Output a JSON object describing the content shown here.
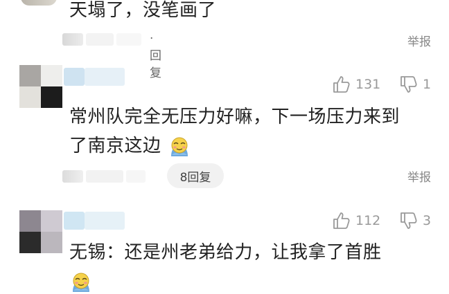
{
  "comments": [
    {
      "text": "天塌了，没笔画了",
      "reply_link": "· 回复",
      "report": "举报"
    },
    {
      "text_line1": "常州队完全无压力好嘛，下一场压力来到",
      "text_line2": "了南京这边",
      "likes": "131",
      "dislikes": "1",
      "replies": "8回复",
      "report": "举报",
      "emoji": "blushing-face-emoji"
    },
    {
      "text_line1": "无锡：还是州老弟给力，让我拿了首胜",
      "likes": "112",
      "dislikes": "3",
      "emoji": "blushing-face-emoji"
    }
  ],
  "icons": {
    "like": "thumbs-up-icon",
    "dislike": "thumbs-down-icon"
  },
  "colors": {
    "text": "#222222",
    "muted": "#999999"
  }
}
